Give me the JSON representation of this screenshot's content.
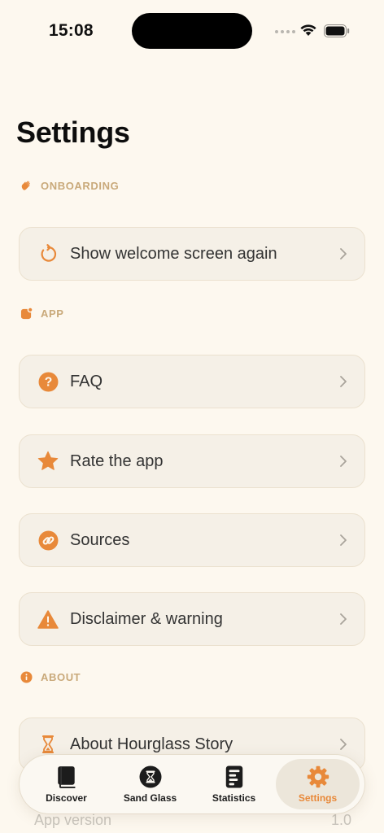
{
  "status_bar": {
    "time": "15:08"
  },
  "page_title": "Settings",
  "sections": {
    "onboarding": {
      "label": "ONBOARDING",
      "icon": "waving-hand-icon"
    },
    "app": {
      "label": "APP",
      "icon": "app-icon"
    },
    "about": {
      "label": "ABOUT",
      "icon": "info-icon"
    }
  },
  "rows": {
    "welcome": {
      "label": "Show welcome screen again",
      "icon": "restart-arrow-icon"
    },
    "faq": {
      "label": "FAQ",
      "icon": "question-circle-icon"
    },
    "rate": {
      "label": "Rate the app",
      "icon": "star-icon"
    },
    "sources": {
      "label": "Sources",
      "icon": "link-circle-icon"
    },
    "disclaimer": {
      "label": "Disclaimer & warning",
      "icon": "warning-triangle-icon"
    },
    "about": {
      "label": "About Hourglass Story",
      "icon": "hourglass-icon"
    }
  },
  "app_version": {
    "label": "App version",
    "value": "1.0"
  },
  "tabs": [
    {
      "label": "Discover",
      "icon": "book-icon",
      "active": false
    },
    {
      "label": "Sand Glass",
      "icon": "hourglass-circle-icon",
      "active": false
    },
    {
      "label": "Statistics",
      "icon": "chart-doc-icon",
      "active": false
    },
    {
      "label": "Settings",
      "icon": "gear-icon",
      "active": true
    }
  ],
  "colors": {
    "accent": "#e8893a",
    "background": "#fdf8ef",
    "section_label": "#c9a97a"
  }
}
